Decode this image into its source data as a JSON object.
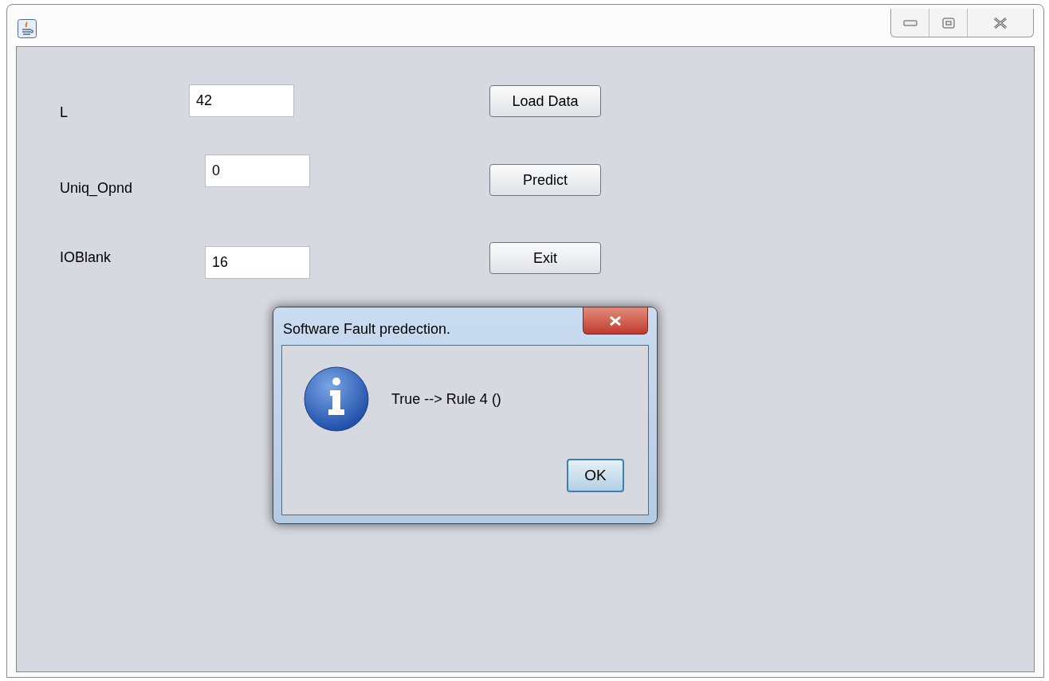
{
  "form": {
    "fields": [
      {
        "label": "L",
        "value": "42"
      },
      {
        "label": "Uniq_Opnd",
        "value": "0"
      },
      {
        "label": "IOBlank",
        "value": "16"
      }
    ],
    "buttons": [
      "Load Data",
      "Predict",
      "Exit"
    ]
  },
  "dialog": {
    "title": "Software Fault predection.",
    "message": "True --> Rule 4 ()",
    "buttons": [
      "OK"
    ]
  }
}
